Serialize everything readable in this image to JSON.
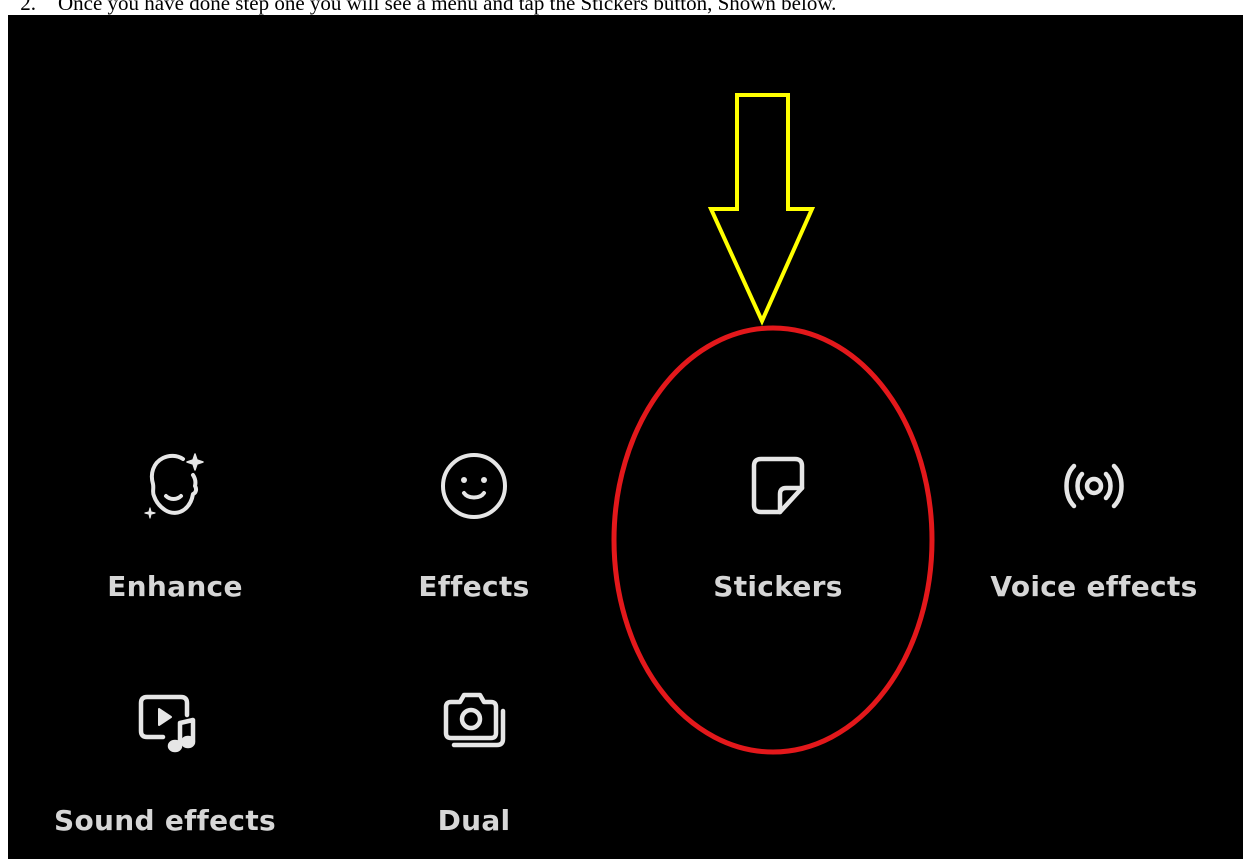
{
  "instruction": {
    "number": "2.",
    "text": "Once you have done step one you will see a menu and tap the Stickers button, Shown below."
  },
  "menu": {
    "items": [
      {
        "label": "Enhance",
        "icon": "enhance-face-icon"
      },
      {
        "label": "Effects",
        "icon": "smiley-face-icon"
      },
      {
        "label": "Stickers",
        "icon": "sticker-icon"
      },
      {
        "label": "Voice effects",
        "icon": "voice-waves-icon"
      },
      {
        "label": "Sound effects",
        "icon": "sound-effects-icon"
      },
      {
        "label": "Dual",
        "icon": "dual-camera-icon"
      }
    ]
  },
  "annotations": {
    "arrow_color": "#ffff00",
    "circle_color": "#e3181b"
  },
  "colors": {
    "background": "#000000",
    "icon": "#e6e6e6",
    "label": "#d6d6d6"
  }
}
